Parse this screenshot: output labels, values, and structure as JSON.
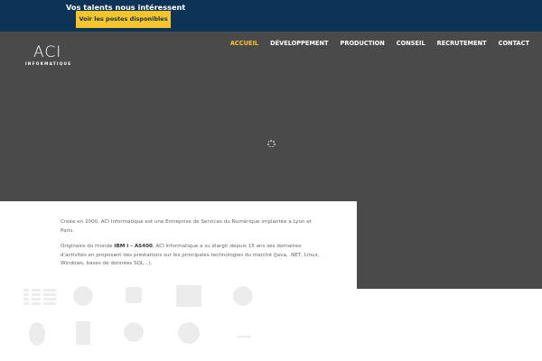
{
  "banner": {
    "text": "Vos talents nous intéressent",
    "button_label": "Voir les postes disponibles"
  },
  "logo": {
    "main": "ACI",
    "sub": "INFORMATIQUE"
  },
  "nav": {
    "items": [
      "ACCUEIL",
      "DÉVELOPPEMENT",
      "PRODUCTION",
      "CONSEIL",
      "RECRUTEMENT",
      "CONTACT"
    ],
    "active": "ACCUEIL"
  },
  "content": {
    "para1": "Créée en 2000, ACI Informatique est une Entreprise de Services du Numérique implantée à Lyon et Paris.",
    "para2_before": "Originaire du monde ",
    "para2_bold": "IBM i – AS400",
    "para2_after": ", ACI informatique a su élargir depuis 15 ans ses domaines d'activités en proposant des prestations sur les principales technologies du marché (Java, .NET, Linux, Windows, bases de données SQL…)."
  },
  "colors": {
    "banner_bg": "#0d3357",
    "accent": "#f7c42a",
    "hero_bg": "#4a4a4a"
  }
}
